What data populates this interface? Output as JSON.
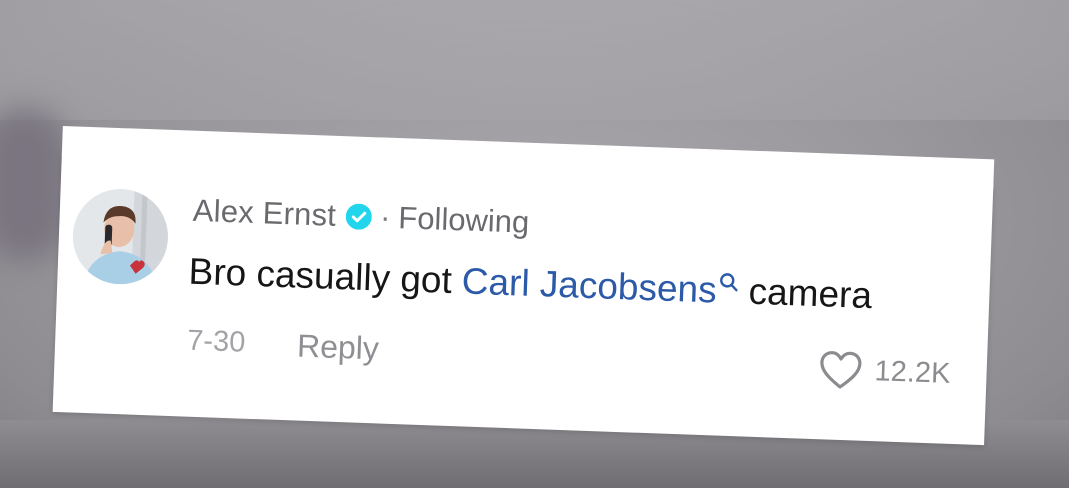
{
  "comment": {
    "author": "Alex Ernst",
    "separator": "·",
    "follow_status": "Following",
    "text_before": "Bro casually got",
    "mention": "Carl Jacobsens",
    "text_after": "camera",
    "date": "7-30",
    "reply_label": "Reply",
    "like_count": "12.2K"
  },
  "icons": {
    "verified": "verified-badge-icon",
    "mention_search": "search-icon",
    "like": "heart-outline-icon"
  },
  "colors": {
    "verified_badge": "#20d5ec",
    "mention_link": "#2c5aa8",
    "background": "#a3a1a5"
  }
}
